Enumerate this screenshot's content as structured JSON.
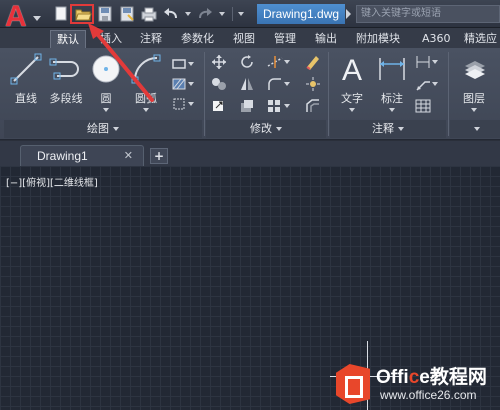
{
  "app": {
    "logo_letter": "A",
    "document_title": "Drawing1.dwg",
    "search_placeholder": "键入关键字或短语"
  },
  "quick_access": {
    "items": [
      "new-icon",
      "open-icon",
      "save-icon",
      "save-as-icon",
      "plot-icon",
      "undo-icon",
      "redo-icon"
    ],
    "highlighted_item": "open-icon"
  },
  "ribbon_tabs": [
    "默认",
    "插入",
    "注释",
    "参数化",
    "视图",
    "管理",
    "输出",
    "附加模块",
    "A360",
    "精选应"
  ],
  "active_tab": "默认",
  "draw_panel": {
    "title": "绘图",
    "tools": [
      {
        "label": "直线",
        "icon": "line-icon"
      },
      {
        "label": "多段线",
        "icon": "polyline-icon"
      },
      {
        "label": "圆",
        "icon": "circle-icon"
      },
      {
        "label": "圆弧",
        "icon": "arc-icon"
      }
    ]
  },
  "modify_panel": {
    "title": "修改"
  },
  "annotation_panel": {
    "title": "注释",
    "tools": [
      {
        "label": "文字",
        "icon": "text-icon"
      },
      {
        "label": "标注",
        "icon": "dimension-icon"
      }
    ]
  },
  "layers_panel": {
    "label": "图层"
  },
  "document_tabs": [
    {
      "name": "Drawing1"
    }
  ],
  "new_tab_symbol": "+",
  "close_symbol": "✕",
  "viewport_label": "[−][俯视][二维线框]",
  "watermark": {
    "brand_a": "Offi",
    "brand_c": "c",
    "brand_b": "e教程网",
    "site": "www.office26.com"
  },
  "colors": {
    "accent_red": "#e23a3a",
    "title_blue": "#3a74b3",
    "canvas_bg": "#222834"
  }
}
